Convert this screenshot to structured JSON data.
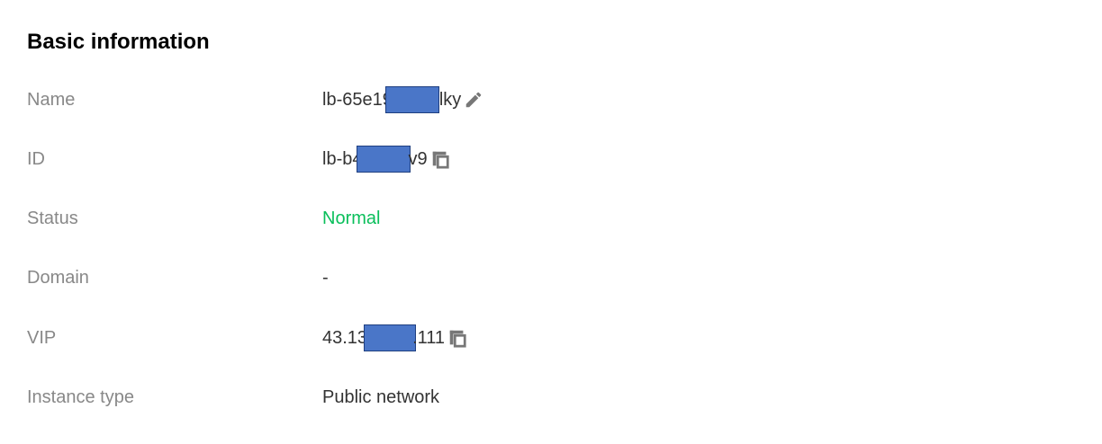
{
  "section": {
    "title": "Basic information"
  },
  "rows": {
    "name": {
      "label": "Name",
      "value_prefix": "lb-65e19",
      "value_suffix": "lky",
      "action_icon": "edit-icon"
    },
    "id": {
      "label": "ID",
      "value_prefix": "lb-b4",
      "value_suffix": "v9",
      "action_icon": "copy-icon"
    },
    "status": {
      "label": "Status",
      "value": "Normal",
      "color": "#0abf5b"
    },
    "domain": {
      "label": "Domain",
      "value": "-"
    },
    "vip": {
      "label": "VIP",
      "value_prefix": "43.13",
      "value_suffix": ".111",
      "action_icon": "copy-icon"
    },
    "instance_type": {
      "label": "Instance type",
      "value": "Public network"
    }
  },
  "colors": {
    "label": "#888888",
    "value": "#333333",
    "status_normal": "#0abf5b",
    "redaction": "#4a76c8"
  }
}
